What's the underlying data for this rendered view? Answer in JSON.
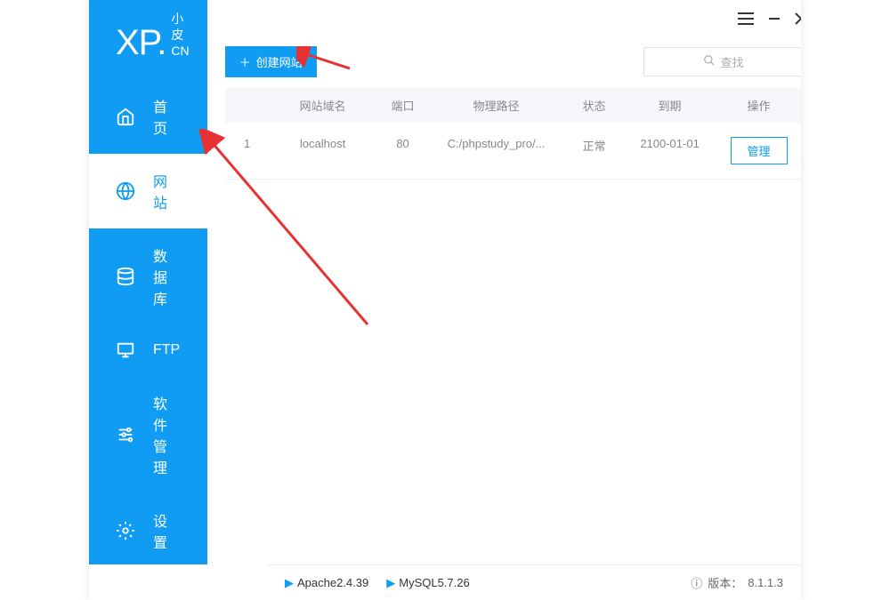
{
  "logo": {
    "main": "XP.",
    "sub1": "小皮",
    "sub2": "CN"
  },
  "sidebar": {
    "items": [
      {
        "label": "首页"
      },
      {
        "label": "网站"
      },
      {
        "label": "数据库"
      },
      {
        "label": "FTP"
      },
      {
        "label": "软件管理"
      },
      {
        "label": "设置"
      }
    ]
  },
  "toolbar": {
    "create_label": "创建网站",
    "search_placeholder": "查找"
  },
  "table": {
    "headers": {
      "domain": "网站域名",
      "port": "端口",
      "path": "物理路径",
      "status": "状态",
      "expire": "到期",
      "action": "操作"
    },
    "rows": [
      {
        "idx": "1",
        "domain": "localhost",
        "port": "80",
        "path": "C:/phpstudy_pro/...",
        "status": "正常",
        "expire": "2100-01-01",
        "action": "管理"
      }
    ]
  },
  "statusbar": {
    "apache": "Apache2.4.39",
    "mysql": "MySQL5.7.26",
    "version_label": "版本：",
    "version": "8.1.1.3"
  }
}
